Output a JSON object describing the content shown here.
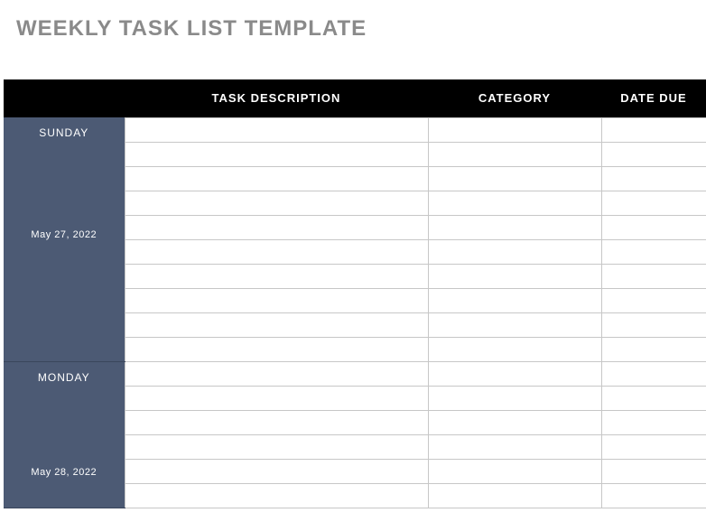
{
  "title": "WEEKLY TASK LIST TEMPLATE",
  "columns": {
    "task": "TASK DESCRIPTION",
    "category": "CATEGORY",
    "due": "DATE DUE"
  },
  "days": [
    {
      "name": "SUNDAY",
      "date": "May 27, 2022",
      "rows": 10
    },
    {
      "name": "MONDAY",
      "date": "May 28, 2022",
      "rows": 6
    }
  ]
}
